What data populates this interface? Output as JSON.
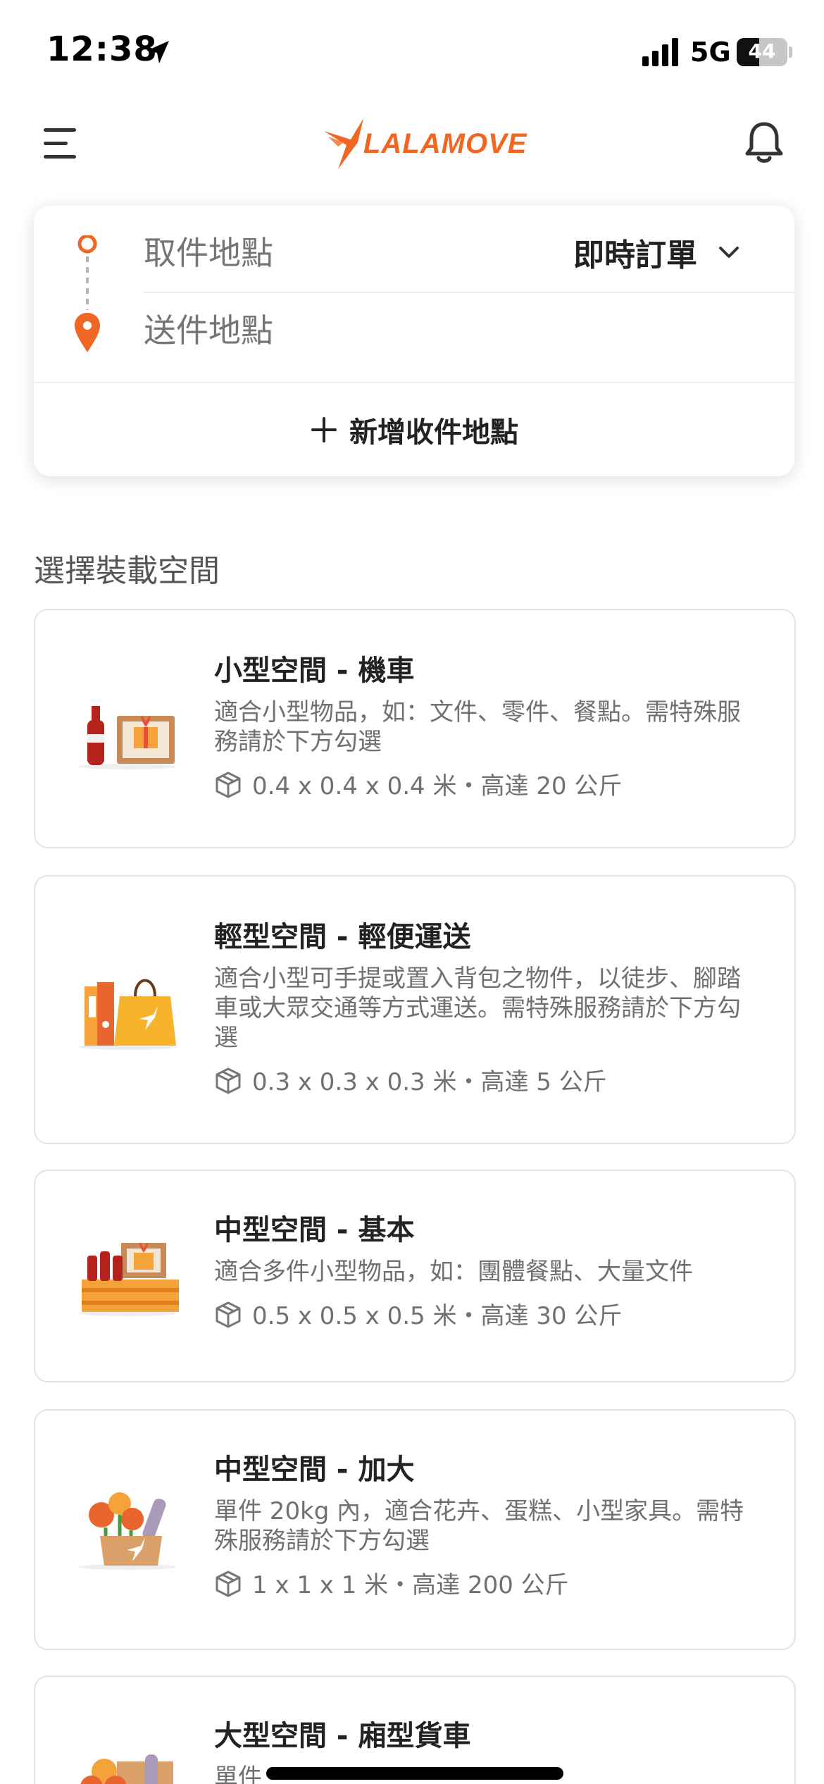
{
  "status_bar": {
    "time": "12:38",
    "network": "5G",
    "battery": "44"
  },
  "header": {
    "brand": "LALAMOVE",
    "brand_color": "#f16622",
    "menu_icon": "hamburger-menu-icon",
    "notification_icon": "bell-icon"
  },
  "address": {
    "pickup_placeholder": "取件地點",
    "dropoff_placeholder": "送件地點",
    "order_type": "即時訂單",
    "add_stop": "新增收件地點"
  },
  "section_title": "選擇裝載空間",
  "vehicles": [
    {
      "title": "小型空間 - 機車",
      "desc": "適合小型物品，如：文件、零件、餐點。需特殊服務請於下方勾選",
      "spec": "0.4 x 0.4 x 0.4 米・高達 20 公斤"
    },
    {
      "title": "輕型空間 - 輕便運送",
      "desc": "適合小型可手提或置入背包之物件，以徒步、腳踏車或大眾交通等方式運送。需特殊服務請於下方勾選",
      "spec": "0.3 x 0.3 x 0.3 米・高達 5 公斤"
    },
    {
      "title": "中型空間 - 基本",
      "desc": "適合多件小型物品，如：團體餐點、大量文件",
      "spec": "0.5 x 0.5 x 0.5 米・高達 30 公斤"
    },
    {
      "title": "中型空間 - 加大",
      "desc": "單件 20kg 內，適合花卉、蛋糕、小型家具。需特殊服務請於下方勾選",
      "spec": "1 x 1 x 1 米・高達 200 公斤"
    },
    {
      "title": "大型空間 - 廂型貨車",
      "desc": "單件",
      "spec": ""
    }
  ]
}
